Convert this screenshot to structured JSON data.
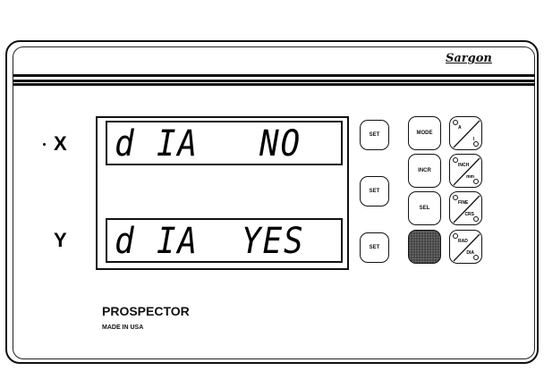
{
  "brand": "Sargon",
  "axes": {
    "x_label": "X",
    "y_label": "Y"
  },
  "displays": {
    "x": {
      "left": "d IA",
      "right": "NO"
    },
    "y": {
      "left": "d IA",
      "right": "YES"
    }
  },
  "set_buttons": [
    "SET",
    "SET",
    "SET"
  ],
  "keys": {
    "mode": "MODE",
    "incr": "INCR",
    "sel": "SEL",
    "blank": ""
  },
  "toggle_keys": [
    {
      "top": "A",
      "bottom": "I"
    },
    {
      "top": "INCH",
      "bottom": "mm"
    },
    {
      "top": "FINE",
      "bottom": "CRS"
    },
    {
      "top": "RAD",
      "bottom": "DIA"
    }
  ],
  "model": "PROSPECTOR",
  "origin": "MADE IN USA",
  "icons": [
    "indicator-led-icon",
    "diagonal-split-icon"
  ]
}
